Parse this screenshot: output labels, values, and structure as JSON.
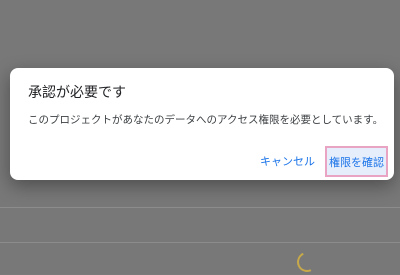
{
  "dialog": {
    "title": "承認が必要です",
    "message": "このプロジェクトがあなたのデータへのアクセス権限を必要としています。",
    "cancel_label": "キャンセル",
    "confirm_label": "権限を確認"
  },
  "colors": {
    "accent": "#1a73e8",
    "highlight_border": "#e8a4c2",
    "overlay": "#787878"
  },
  "icons": {
    "loading": "loading-spinner-icon"
  }
}
